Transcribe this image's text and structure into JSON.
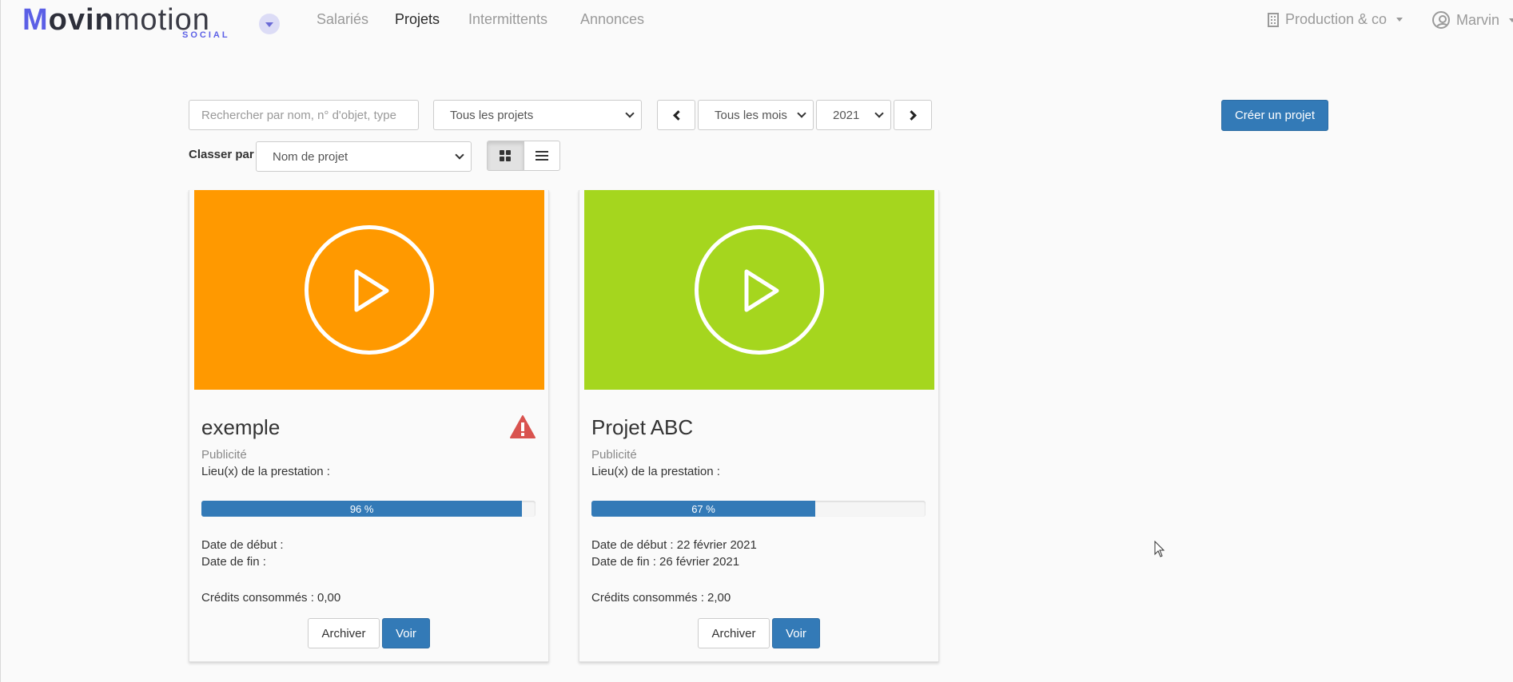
{
  "header": {
    "logo": {
      "part1": "M",
      "part2": "ovin",
      "part3": "motion",
      "sub": "SOCIAL"
    },
    "nav": [
      "Salariés",
      "Projets",
      "Intermittents",
      "Annonces"
    ],
    "active_nav": "Projets",
    "company": "Production & co",
    "user": "Marvin"
  },
  "filters": {
    "search_placeholder": "Rechercher par nom, n° d'objet, type",
    "projects_select": "Tous les projets",
    "month_select": "Tous les mois",
    "year_select": "2021",
    "create_button": "Créer un projet",
    "sort_label": "Classer par :",
    "sort_select": "Nom de projet"
  },
  "projects": [
    {
      "title": "exemple",
      "type": "Publicité",
      "place_label": "Lieu(x) de la prestation :",
      "progress": 96,
      "progress_label": "96 %",
      "start_label": "Date de début :",
      "end_label": "Date de fin :",
      "credits_label": "Crédits consommés : 0,00",
      "archive_label": "Archiver",
      "view_label": "Voir",
      "color": "#ff9900",
      "warning": true
    },
    {
      "title": "Projet ABC",
      "type": "Publicité",
      "place_label": "Lieu(x) de la prestation :",
      "progress": 67,
      "progress_label": "67 %",
      "start_label": "Date de début : 22 février 2021",
      "end_label": "Date de fin : 26 février 2021",
      "credits_label": "Crédits consommés : 2,00",
      "archive_label": "Archiver",
      "view_label": "Voir",
      "color": "#a5d61e",
      "warning": false
    }
  ],
  "colors": {
    "primary": "#337ab7",
    "warning": "#d9534f",
    "logo_accent": "#5b5fe6"
  },
  "icons": [
    "building-icon",
    "user-icon",
    "chevron-left-icon",
    "chevron-right-icon",
    "grid-view-icon",
    "list-view-icon",
    "play-icon",
    "warning-icon"
  ]
}
